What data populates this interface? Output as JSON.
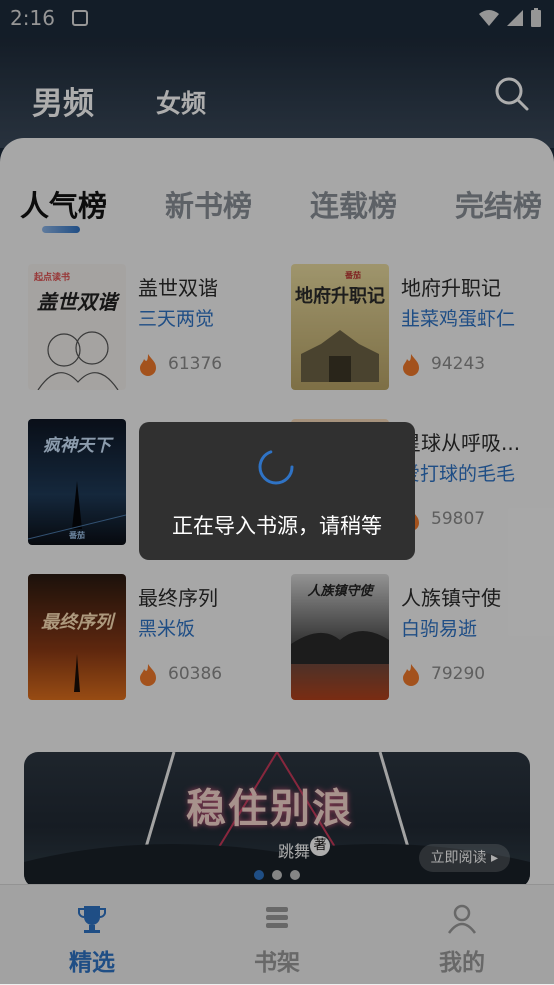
{
  "status_bar": {
    "time": "2:16"
  },
  "top_tabs": [
    {
      "label": "男频"
    },
    {
      "label": "女频"
    }
  ],
  "rank_tabs": [
    {
      "label": "人气榜"
    },
    {
      "label": "新书榜"
    },
    {
      "label": "连载榜"
    },
    {
      "label": "完结榜"
    }
  ],
  "books": [
    {
      "title": "盖世双谐",
      "author": "三天两觉",
      "hot": "61376",
      "cover_text": "盖世双谐",
      "cover_badge": "起点读书"
    },
    {
      "title": "地府升职记",
      "author": "韭菜鸡蛋虾仁",
      "hot": "94243",
      "cover_text": "地府升职记",
      "cover_badge": "番茄"
    },
    {
      "title": "",
      "author": "",
      "hot": "",
      "cover_text": "疯神天下",
      "cover_badge": "番茄"
    },
    {
      "title": "星球从呼吸...",
      "author": "爱打球的毛毛",
      "hot": "59807",
      "cover_text": "",
      "cover_badge": ""
    },
    {
      "title": "最终序列",
      "author": "黑米饭",
      "hot": "60386",
      "cover_text": "最终序列",
      "cover_badge": ""
    },
    {
      "title": "人族镇守使",
      "author": "白驹易逝",
      "hot": "79290",
      "cover_text": "人族镇守使",
      "cover_badge": ""
    }
  ],
  "banner": {
    "title": "稳住别浪",
    "author": "跳舞",
    "author_suffix": "著",
    "read_label": "立即阅读 ▸"
  },
  "bottom_nav": [
    {
      "label": "精选"
    },
    {
      "label": "书架"
    },
    {
      "label": "我的"
    }
  ],
  "toast": {
    "text": "正在导入书源，请稍等"
  },
  "colors": {
    "accent": "#2f73c5",
    "hot": "#f07a2b"
  }
}
